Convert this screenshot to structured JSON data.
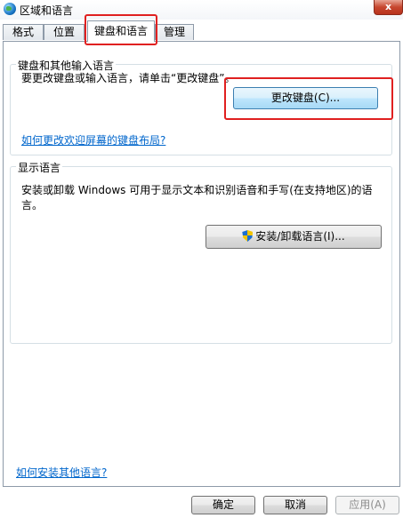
{
  "window": {
    "title": "区域和语言",
    "close_glyph": "x"
  },
  "tabs": [
    {
      "label": "格式"
    },
    {
      "label": "位置"
    },
    {
      "label": "键盘和语言",
      "active": true
    },
    {
      "label": "管理"
    }
  ],
  "keyboard_section": {
    "title": "键盘和其他输入语言",
    "description": "要更改键盘或输入语言，请单击“更改键盘”。",
    "change_button": "更改键盘(C)...",
    "welcome_link": "如何更改欢迎屏幕的键盘布局?"
  },
  "display_section": {
    "title": "显示语言",
    "description": "安装或卸载 Windows 可用于显示文本和识别语音和手写(在支持地区)的语言。",
    "install_button": "安装/卸载语言(I)...",
    "install_icon": "uac-shield-icon"
  },
  "install_other_link": "如何安装其他语言?",
  "footer": {
    "ok": "确定",
    "cancel": "取消",
    "apply": "应用(A)"
  },
  "colors": {
    "highlight": "#e02020",
    "link": "#0066cc"
  }
}
